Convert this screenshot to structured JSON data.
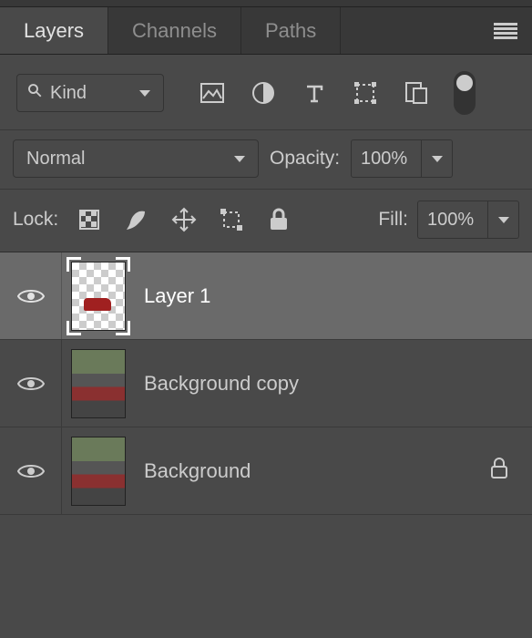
{
  "tabs": {
    "layers": "Layers",
    "channels": "Channels",
    "paths": "Paths",
    "active": "layers"
  },
  "filter": {
    "label": "Kind"
  },
  "blend": {
    "mode": "Normal",
    "opacity_label": "Opacity:",
    "opacity_value": "100%"
  },
  "lock": {
    "label": "Lock:",
    "fill_label": "Fill:",
    "fill_value": "100%"
  },
  "layers": [
    {
      "name": "Layer 1",
      "visible": true,
      "selected": true,
      "locked": false,
      "thumb": "checker"
    },
    {
      "name": "Background copy",
      "visible": true,
      "selected": false,
      "locked": false,
      "thumb": "photo"
    },
    {
      "name": "Background",
      "visible": true,
      "selected": false,
      "locked": true,
      "thumb": "photo"
    }
  ],
  "colors": {
    "panel": "#494949",
    "active_row": "#6a6a6a",
    "text": "#cccccc"
  }
}
